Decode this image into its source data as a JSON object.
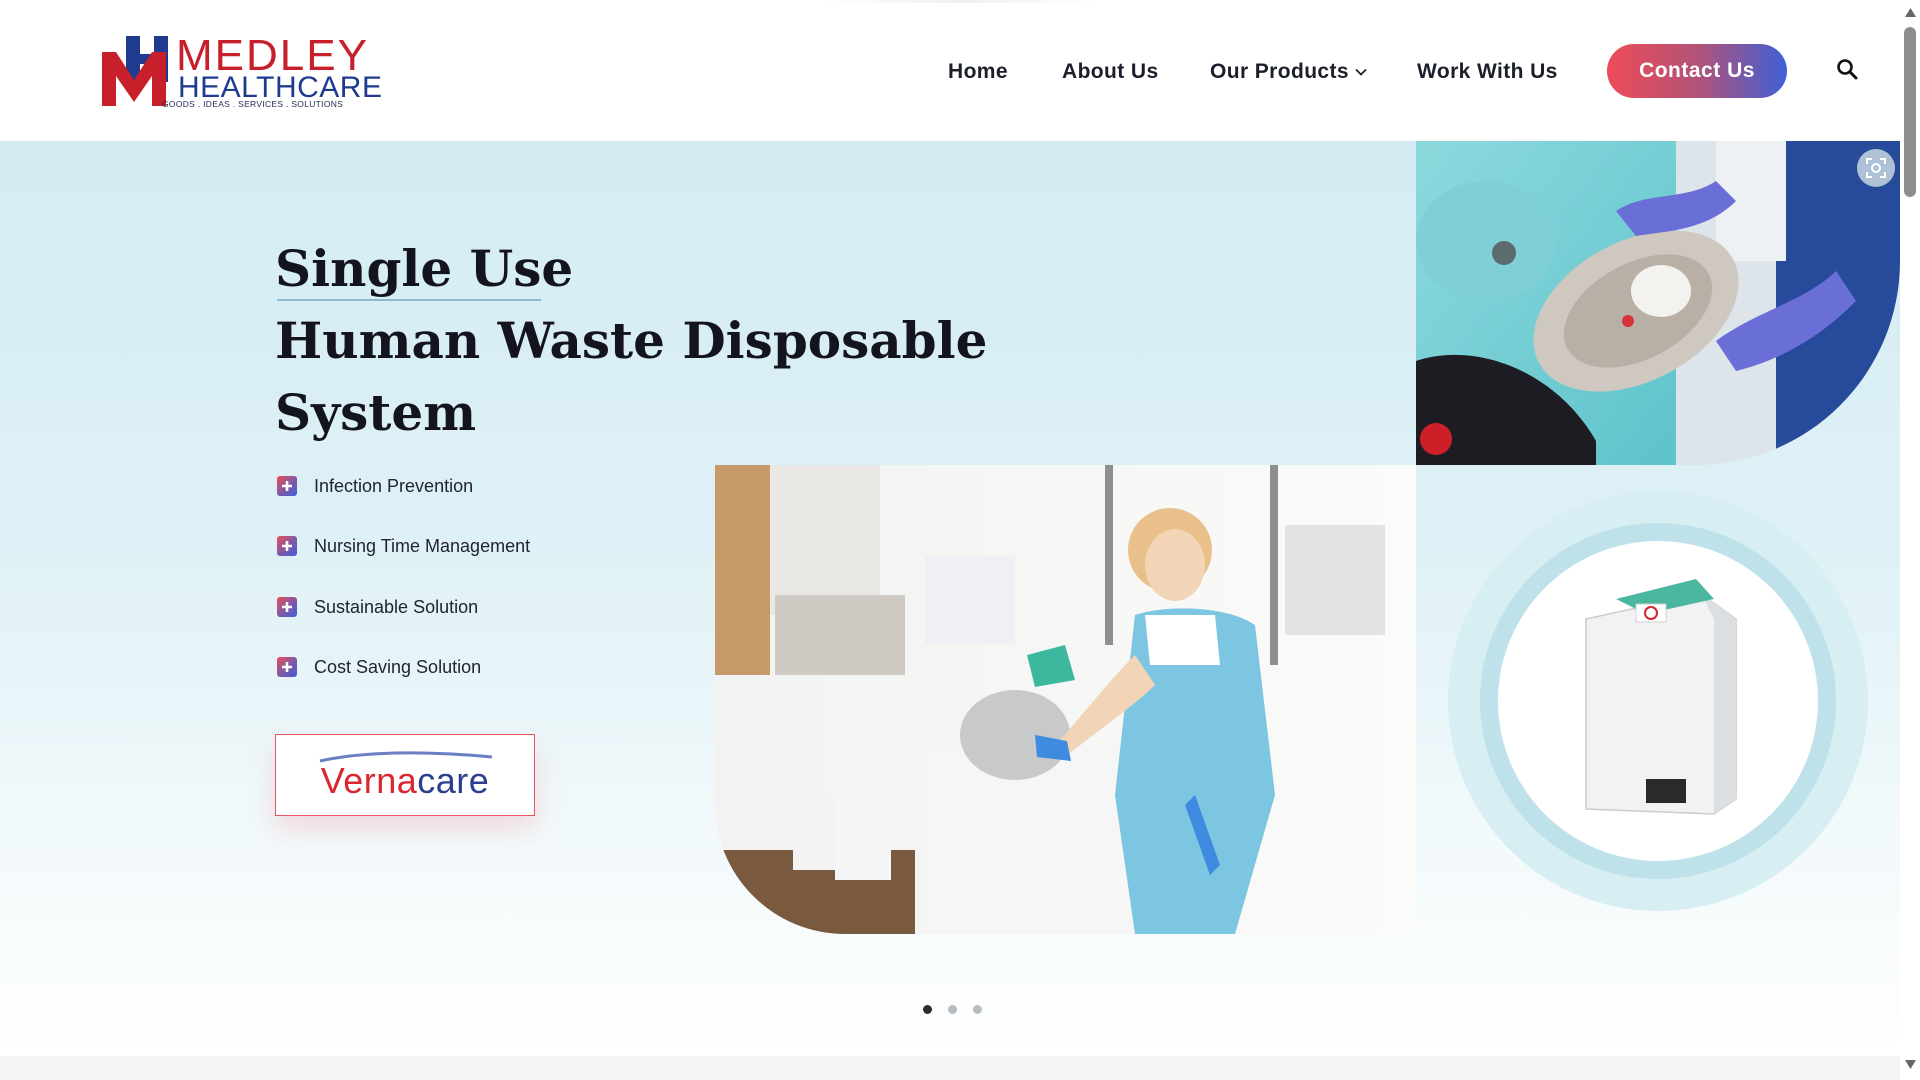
{
  "brand": {
    "name_line1": "MEDLEY",
    "name_line2": "HEALTHCARE",
    "tagline": "GOODS . IDEAS . SERVICES . SOLUTIONS",
    "colors": {
      "red": "#c8202b",
      "blue": "#1f3b8f"
    }
  },
  "nav": {
    "items": [
      {
        "label": "Home"
      },
      {
        "label": "About Us"
      },
      {
        "label": "Our Products",
        "icon": "chevron-down-icon"
      },
      {
        "label": "Work With Us"
      }
    ],
    "contact_label": "Contact Us",
    "search_icon": "search-icon",
    "colors": {
      "contact_gradient_start": "#ee4b57",
      "contact_gradient_end": "#3f5fd8"
    }
  },
  "hero": {
    "title_line1": "Single Use",
    "title_line2": "Human Waste Disposable",
    "title_line3": "System",
    "features": [
      {
        "label": "Infection Prevention",
        "icon": "plus-icon"
      },
      {
        "label": "Nursing Time Management",
        "icon": "plus-icon"
      },
      {
        "label": "Sustainable Solution",
        "icon": "plus-icon"
      },
      {
        "label": "Cost Saving Solution",
        "icon": "plus-icon"
      }
    ],
    "brand_logo": {
      "part1": "Verna",
      "part2": "care"
    },
    "images": {
      "top": "hands-placing-pulp-bedpan-into-machine",
      "main": "nurse-using-disposal-unit",
      "ring": "macerator-unit-product"
    },
    "fullscreen_icon": "fullscreen-icon",
    "carousel": {
      "slide_count": 3,
      "active_index": 0
    }
  }
}
